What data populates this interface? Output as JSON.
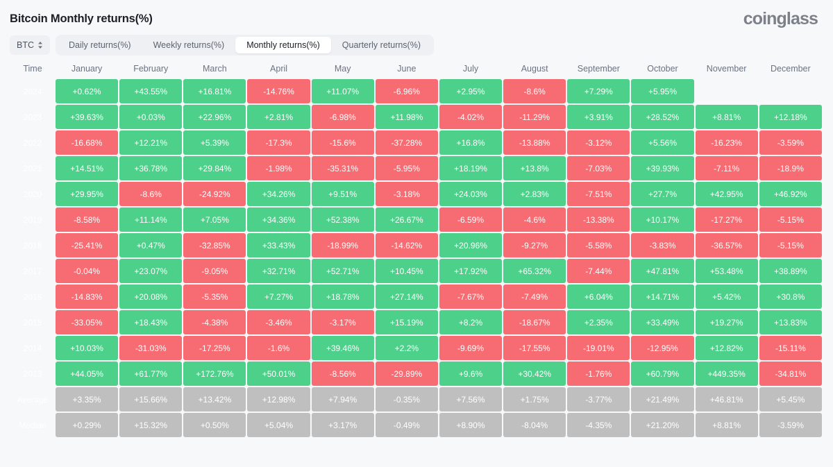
{
  "header": {
    "title": "Bitcoin Monthly returns(%)",
    "brand": "coinglass"
  },
  "toolbar": {
    "asset": "BTC",
    "asset_caret_icon": "chevron-updown-icon",
    "tabs": [
      {
        "label": "Daily returns(%)",
        "active": false
      },
      {
        "label": "Weekly returns(%)",
        "active": false
      },
      {
        "label": "Monthly returns(%)",
        "active": true
      },
      {
        "label": "Quarterly returns(%)",
        "active": false
      }
    ]
  },
  "chart_data": {
    "type": "heatmap",
    "title": "Bitcoin Monthly returns(%)",
    "xlabel": "",
    "ylabel": "Time",
    "columns": [
      "Time",
      "January",
      "February",
      "March",
      "April",
      "May",
      "June",
      "July",
      "August",
      "September",
      "October",
      "November",
      "December"
    ],
    "rows": [
      {
        "label": "2024",
        "kind": "year",
        "values": [
          "+0.62%",
          "+43.55%",
          "+16.81%",
          "-14.76%",
          "+11.07%",
          "-6.96%",
          "+2.95%",
          "-8.6%",
          "+7.29%",
          "+5.95%",
          "",
          ""
        ]
      },
      {
        "label": "2023",
        "kind": "year",
        "values": [
          "+39.63%",
          "+0.03%",
          "+22.96%",
          "+2.81%",
          "-6.98%",
          "+11.98%",
          "-4.02%",
          "-11.29%",
          "+3.91%",
          "+28.52%",
          "+8.81%",
          "+12.18%"
        ]
      },
      {
        "label": "2022",
        "kind": "year",
        "values": [
          "-16.68%",
          "+12.21%",
          "+5.39%",
          "-17.3%",
          "-15.6%",
          "-37.28%",
          "+16.8%",
          "-13.88%",
          "-3.12%",
          "+5.56%",
          "-16.23%",
          "-3.59%"
        ]
      },
      {
        "label": "2021",
        "kind": "year",
        "values": [
          "+14.51%",
          "+36.78%",
          "+29.84%",
          "-1.98%",
          "-35.31%",
          "-5.95%",
          "+18.19%",
          "+13.8%",
          "-7.03%",
          "+39.93%",
          "-7.11%",
          "-18.9%"
        ]
      },
      {
        "label": "2020",
        "kind": "year",
        "values": [
          "+29.95%",
          "-8.6%",
          "-24.92%",
          "+34.26%",
          "+9.51%",
          "-3.18%",
          "+24.03%",
          "+2.83%",
          "-7.51%",
          "+27.7%",
          "+42.95%",
          "+46.92%"
        ]
      },
      {
        "label": "2019",
        "kind": "year",
        "values": [
          "-8.58%",
          "+11.14%",
          "+7.05%",
          "+34.36%",
          "+52.38%",
          "+26.67%",
          "-6.59%",
          "-4.6%",
          "-13.38%",
          "+10.17%",
          "-17.27%",
          "-5.15%"
        ]
      },
      {
        "label": "2018",
        "kind": "year",
        "values": [
          "-25.41%",
          "+0.47%",
          "-32.85%",
          "+33.43%",
          "-18.99%",
          "-14.62%",
          "+20.96%",
          "-9.27%",
          "-5.58%",
          "-3.83%",
          "-36.57%",
          "-5.15%"
        ]
      },
      {
        "label": "2017",
        "kind": "year",
        "values": [
          "-0.04%",
          "+23.07%",
          "-9.05%",
          "+32.71%",
          "+52.71%",
          "+10.45%",
          "+17.92%",
          "+65.32%",
          "-7.44%",
          "+47.81%",
          "+53.48%",
          "+38.89%"
        ]
      },
      {
        "label": "2016",
        "kind": "year",
        "values": [
          "-14.83%",
          "+20.08%",
          "-5.35%",
          "+7.27%",
          "+18.78%",
          "+27.14%",
          "-7.67%",
          "-7.49%",
          "+6.04%",
          "+14.71%",
          "+5.42%",
          "+30.8%"
        ]
      },
      {
        "label": "2015",
        "kind": "year",
        "values": [
          "-33.05%",
          "+18.43%",
          "-4.38%",
          "-3.46%",
          "-3.17%",
          "+15.19%",
          "+8.2%",
          "-18.67%",
          "+2.35%",
          "+33.49%",
          "+19.27%",
          "+13.83%"
        ]
      },
      {
        "label": "2014",
        "kind": "year",
        "values": [
          "+10.03%",
          "-31.03%",
          "-17.25%",
          "-1.6%",
          "+39.46%",
          "+2.2%",
          "-9.69%",
          "-17.55%",
          "-19.01%",
          "-12.95%",
          "+12.82%",
          "-15.11%"
        ]
      },
      {
        "label": "2013",
        "kind": "year",
        "values": [
          "+44.05%",
          "+61.77%",
          "+172.76%",
          "+50.01%",
          "-8.56%",
          "-29.89%",
          "+9.6%",
          "+30.42%",
          "-1.76%",
          "+60.79%",
          "+449.35%",
          "-34.81%"
        ]
      },
      {
        "label": "Average",
        "kind": "stat",
        "values": [
          "+3.35%",
          "+15.66%",
          "+13.42%",
          "+12.98%",
          "+7.94%",
          "-0.35%",
          "+7.56%",
          "+1.75%",
          "-3.77%",
          "+21.49%",
          "+46.81%",
          "+5.45%"
        ]
      },
      {
        "label": "Median",
        "kind": "stat",
        "values": [
          "+0.29%",
          "+15.32%",
          "+0.50%",
          "+5.04%",
          "+3.17%",
          "-0.49%",
          "+8.90%",
          "-8.04%",
          "-4.35%",
          "+21.20%",
          "+8.81%",
          "-3.59%"
        ]
      }
    ],
    "colors": {
      "positive": "#4cd08a",
      "negative": "#f76b72",
      "stat": "#bfbfbf",
      "background": "#f7f8fa"
    }
  }
}
